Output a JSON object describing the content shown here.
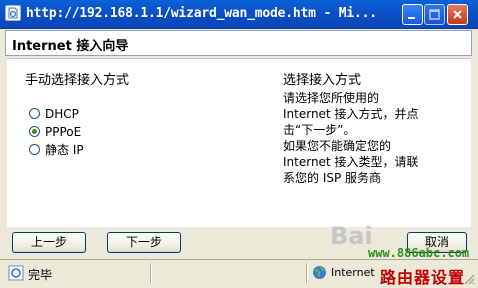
{
  "window": {
    "title": "http://192.168.1.1/wizard_wan_mode.htm - Mi...",
    "minimize_label": "minimize",
    "maximize_label": "maximize",
    "close_label": "close"
  },
  "wizard": {
    "header": "Internet 接入向导",
    "left_heading": "手动选择接入方式",
    "right_heading": "选择接入方式",
    "description_lines": [
      "请选择您所使用的",
      "Internet 接入方式，并点",
      "击“下一步”。",
      "如果您不能确定您的",
      "Internet 接入类型，请联",
      "系您的 ISP 服务商"
    ],
    "options": [
      {
        "label": "DHCP",
        "checked": false
      },
      {
        "label": "PPPoE",
        "checked": true
      },
      {
        "label": "静态 IP",
        "checked": false
      }
    ]
  },
  "buttons": {
    "prev": "上一步",
    "next": "下一步",
    "cancel": "取消"
  },
  "statusbar": {
    "text": "完毕",
    "zone": "Internet"
  },
  "watermarks": {
    "site": "www.886abc.com",
    "title": "路由器设置",
    "baidu": "Bai"
  },
  "colors": {
    "titlebar": "#0b4fc7",
    "radio_checked": "#2e8b2e",
    "watermark_site": "#2a8f1c",
    "watermark_title": "#c00000"
  }
}
